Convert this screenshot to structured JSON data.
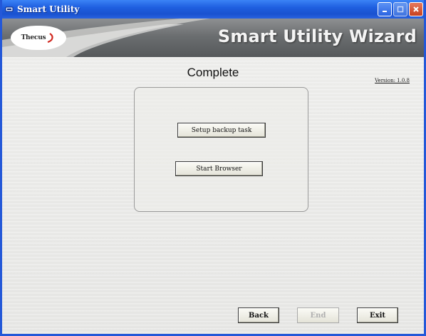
{
  "window": {
    "title": "Smart Utility"
  },
  "titlebar_buttons": {
    "minimize_icon": "minimize-icon",
    "maximize_icon": "maximize-icon",
    "close_icon": "close-icon"
  },
  "banner": {
    "logo_text": "Thecus",
    "title": "Smart Utility Wizard"
  },
  "page": {
    "heading": "Complete",
    "version": "Version: 1.0.8"
  },
  "options": {
    "setup_backup_label": "Setup backup task",
    "start_browser_label": "Start Browser"
  },
  "footer": {
    "back_label": "Back",
    "end_label": "End",
    "exit_label": "Exit"
  },
  "colors": {
    "titlebar": "#1f5fe0",
    "banner": "#6b6e70",
    "body": "#e9e9e7"
  }
}
